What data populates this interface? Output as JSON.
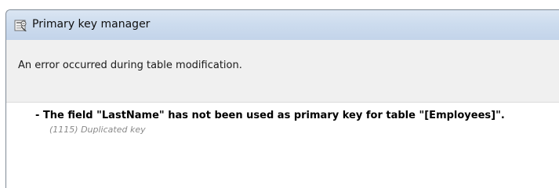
{
  "window": {
    "title": "Primary key manager",
    "icon": "app-database-icon"
  },
  "message": {
    "text": "An error occurred during table modification."
  },
  "errors": [
    {
      "text": "- The field \"LastName\" has not been used as primary key for table \"[Employees]\".",
      "code": "(1115) Duplicated key"
    }
  ]
}
